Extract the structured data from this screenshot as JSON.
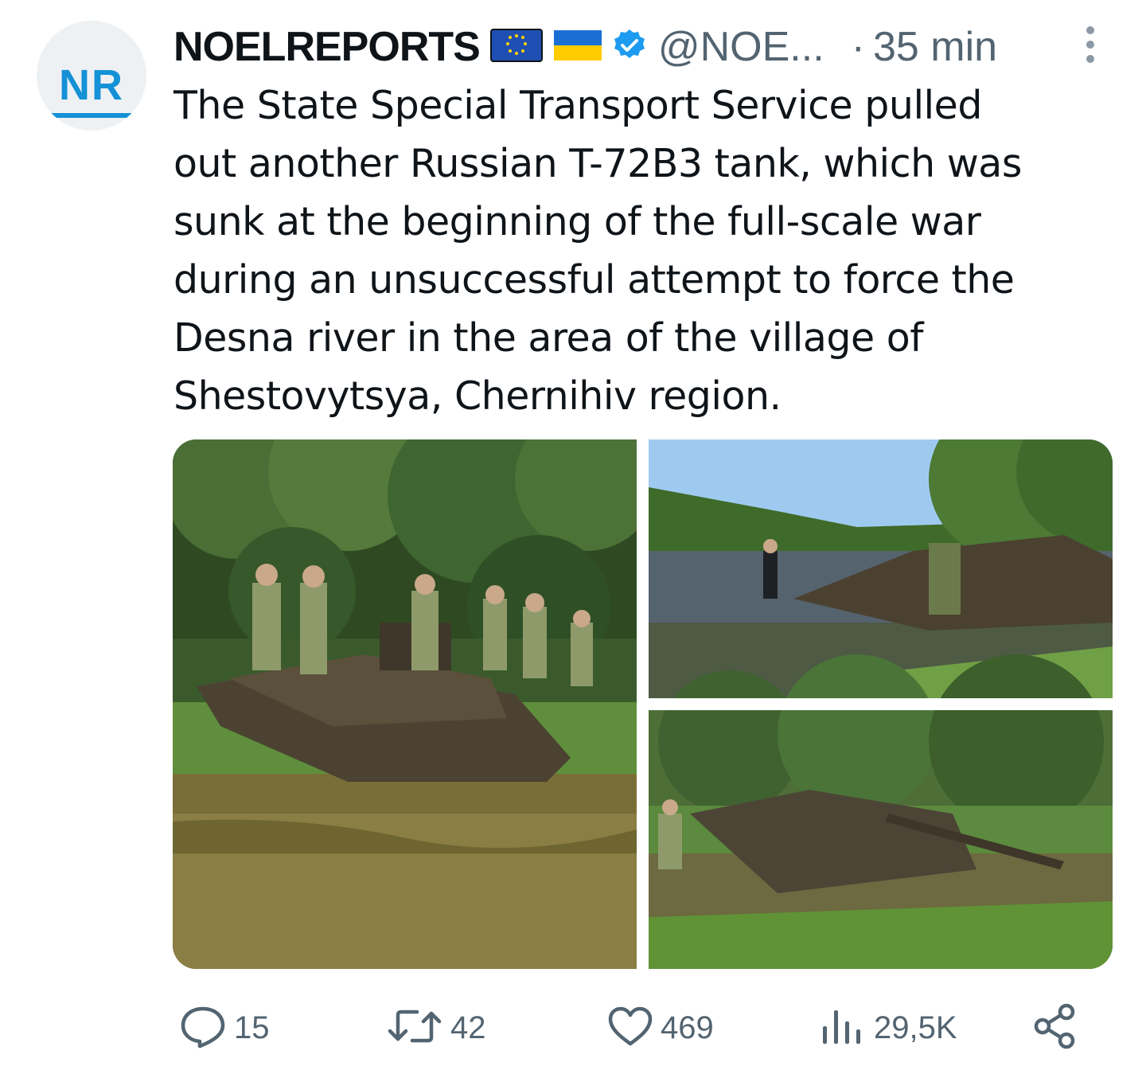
{
  "avatar": {
    "initials": "NR"
  },
  "author": {
    "name": "NOELREPORTS",
    "flags": [
      "eu-flag-icon",
      "ukraine-flag-icon"
    ],
    "verified": true,
    "handle": "@NOE...",
    "separator": "·",
    "time": "35 min"
  },
  "tweet": {
    "text": "The State Special Transport Service pulled\nout another Russian T-72B3 tank, which was\nsunk at the beginning of the full-scale war\nduring an unsuccessful attempt to force the\nDesna river in the area of the village of\nShestovytsya, Chernihiv region."
  },
  "actions": {
    "replies": "15",
    "reposts": "42",
    "likes": "469",
    "views": "29,5K"
  },
  "colors": {
    "text": "#0f1419",
    "muted": "#536471",
    "verified": "#1d9bf0",
    "brand": "#1591d6"
  },
  "icons": {
    "reply": "speech-bubble-icon",
    "repost": "repost-arrows-icon",
    "like": "heart-icon",
    "views": "bar-chart-icon",
    "share": "share-nodes-icon",
    "more": "vertical-dots-icon"
  }
}
